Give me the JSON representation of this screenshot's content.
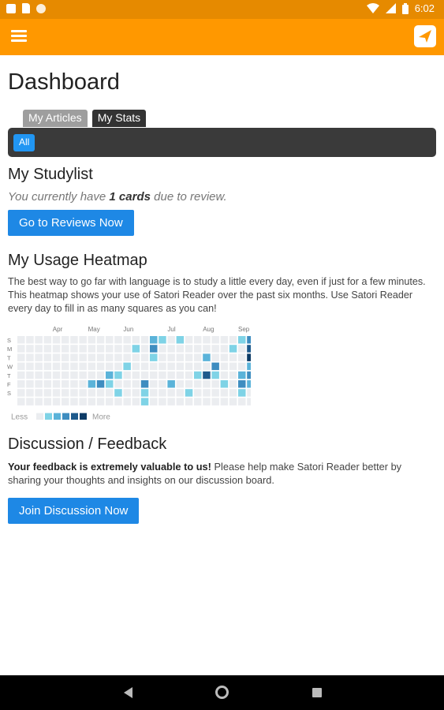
{
  "status_bar": {
    "time": "6:02",
    "icons": [
      "notification-icon",
      "sd-card-icon",
      "circle-icon",
      "wifi-icon",
      "signal-icon",
      "battery-icon"
    ]
  },
  "app_bar": {
    "menu_icon": "hamburger-menu-icon",
    "logo_icon": "satori-logo-icon",
    "color": "#FF9800"
  },
  "page": {
    "title": "Dashboard"
  },
  "tabs": [
    {
      "label": "My Articles",
      "active": false
    },
    {
      "label": "My Stats",
      "active": true
    }
  ],
  "filter": {
    "label": "All"
  },
  "studylist": {
    "heading": "My Studylist",
    "text_prefix": "You currently have ",
    "card_count": "1 cards",
    "text_suffix": " due to review.",
    "button_label": "Go to Reviews Now"
  },
  "heatmap": {
    "heading": "My Usage Heatmap",
    "description": "The best way to go far with language is to study a little every day, even if just for a few minutes. This heatmap shows your use of Satori Reader over the past six months. Use Satori Reader every day to fill in as many squares as you can!",
    "months": [
      "Apr",
      "May",
      "Jun",
      "Jul",
      "Aug",
      "Sep"
    ],
    "month_columns": [
      4,
      8,
      12,
      17,
      21,
      25
    ],
    "days": [
      "S",
      "M",
      "T",
      "W",
      "T",
      "F",
      "S"
    ],
    "legend_less": "Less",
    "legend_more": "More",
    "colors": [
      "#EBEDF0",
      "#7FD3E6",
      "#5BB3D9",
      "#3E8DC0",
      "#1E5A8C",
      "#0D3B66"
    ],
    "weeks": 26,
    "active_cells": [
      {
        "w": 15,
        "d": 2,
        "l": 1
      },
      {
        "w": 15,
        "d": 1,
        "l": 3
      },
      {
        "w": 16,
        "d": 0,
        "l": 1
      },
      {
        "w": 15,
        "d": 0,
        "l": 2
      },
      {
        "w": 13,
        "d": 1,
        "l": 1
      },
      {
        "w": 12,
        "d": 3,
        "l": 1
      },
      {
        "w": 8,
        "d": 5,
        "l": 2
      },
      {
        "w": 9,
        "d": 5,
        "l": 3
      },
      {
        "w": 10,
        "d": 5,
        "l": 1
      },
      {
        "w": 11,
        "d": 6,
        "l": 1
      },
      {
        "w": 11,
        "d": 4,
        "l": 1
      },
      {
        "w": 10,
        "d": 4,
        "l": 2
      },
      {
        "w": 14,
        "d": 5,
        "l": 3
      },
      {
        "w": 14,
        "d": 6,
        "l": 1
      },
      {
        "w": 14,
        "d": 7,
        "l": 1
      },
      {
        "w": 17,
        "d": 5,
        "l": 2
      },
      {
        "w": 18,
        "d": 0,
        "l": 1
      },
      {
        "w": 19,
        "d": 6,
        "l": 1
      },
      {
        "w": 20,
        "d": 4,
        "l": 1
      },
      {
        "w": 21,
        "d": 4,
        "l": 4
      },
      {
        "w": 21,
        "d": 2,
        "l": 2
      },
      {
        "w": 22,
        "d": 3,
        "l": 3
      },
      {
        "w": 22,
        "d": 4,
        "l": 1
      },
      {
        "w": 23,
        "d": 5,
        "l": 1
      },
      {
        "w": 24,
        "d": 1,
        "l": 1
      },
      {
        "w": 25,
        "d": 0,
        "l": 1
      },
      {
        "w": 26,
        "d": 0,
        "l": 3
      },
      {
        "w": 26,
        "d": 1,
        "l": 4
      },
      {
        "w": 26,
        "d": 2,
        "l": 5
      },
      {
        "w": 26,
        "d": 3,
        "l": 2
      },
      {
        "w": 26,
        "d": 4,
        "l": 3
      },
      {
        "w": 26,
        "d": 5,
        "l": 2
      },
      {
        "w": 25,
        "d": 4,
        "l": 2
      },
      {
        "w": 25,
        "d": 5,
        "l": 3
      },
      {
        "w": 25,
        "d": 6,
        "l": 1
      }
    ]
  },
  "discussion": {
    "heading": "Discussion / Feedback",
    "bold_text": "Your feedback is extremely valuable to us!",
    "text": " Please help make Satori Reader better by sharing your thoughts and insights on our discussion board.",
    "button_label": "Join Discussion Now"
  },
  "nav_bar": {
    "icons": [
      "back-icon",
      "home-icon",
      "recents-icon"
    ]
  }
}
